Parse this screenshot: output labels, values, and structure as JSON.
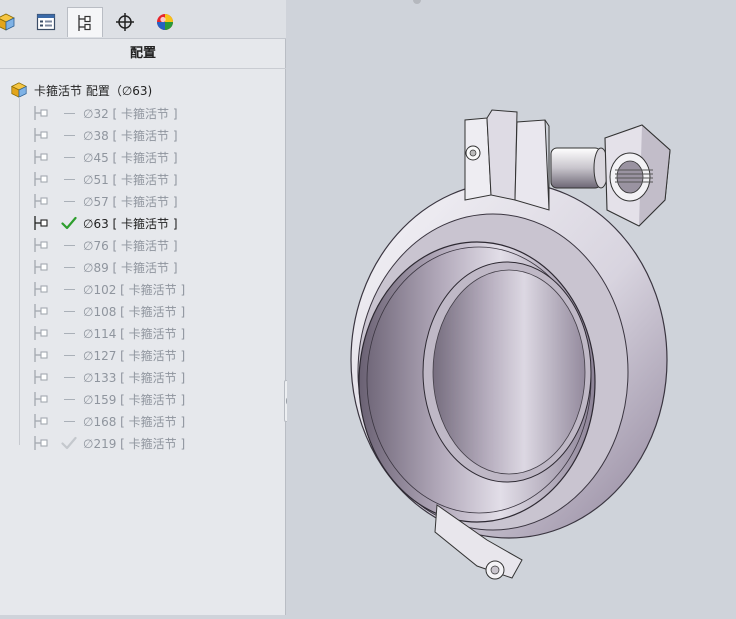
{
  "panel": {
    "tabs": [
      {
        "icon": "part-cube-icon"
      },
      {
        "icon": "property-manager-icon"
      },
      {
        "icon": "configuration-manager-icon",
        "active": true
      },
      {
        "icon": "dimxpert-crosshair-icon"
      },
      {
        "icon": "display-manager-sphere-icon"
      }
    ],
    "title": "配置",
    "root": {
      "label": "卡箍活节 配置（∅63)"
    },
    "configs": [
      {
        "label": "∅32 [ 卡箍活节 ]",
        "active": false,
        "status": "dash"
      },
      {
        "label": "∅38 [ 卡箍活节 ]",
        "active": false,
        "status": "dash"
      },
      {
        "label": "∅45 [ 卡箍活节 ]",
        "active": false,
        "status": "dash"
      },
      {
        "label": "∅51 [ 卡箍活节 ]",
        "active": false,
        "status": "dash"
      },
      {
        "label": "∅57 [ 卡箍活节 ]",
        "active": false,
        "status": "dash"
      },
      {
        "label": "∅63 [ 卡箍活节 ]",
        "active": true,
        "status": "check"
      },
      {
        "label": "∅76 [ 卡箍活节 ]",
        "active": false,
        "status": "dash"
      },
      {
        "label": "∅89 [ 卡箍活节 ]",
        "active": false,
        "status": "dash"
      },
      {
        "label": "∅102 [ 卡箍活节 ]",
        "active": false,
        "status": "dash"
      },
      {
        "label": "∅108 [ 卡箍活节 ]",
        "active": false,
        "status": "dash"
      },
      {
        "label": "∅114 [ 卡箍活节 ]",
        "active": false,
        "status": "dash"
      },
      {
        "label": "∅127 [ 卡箍活节 ]",
        "active": false,
        "status": "dash"
      },
      {
        "label": "∅133 [ 卡箍活节 ]",
        "active": false,
        "status": "dash"
      },
      {
        "label": "∅159 [ 卡箍活节 ]",
        "active": false,
        "status": "dash"
      },
      {
        "label": "∅168 [ 卡箍活节 ]",
        "active": false,
        "status": "dash"
      },
      {
        "label": "∅219 [ 卡箍活节 ]",
        "active": false,
        "status": "check-dim"
      }
    ]
  },
  "colors": {
    "check": "#2e9e2e",
    "check_dim": "#c4c8cd",
    "model_light": "#e9e7ee",
    "model_dark": "#8a7f95"
  }
}
